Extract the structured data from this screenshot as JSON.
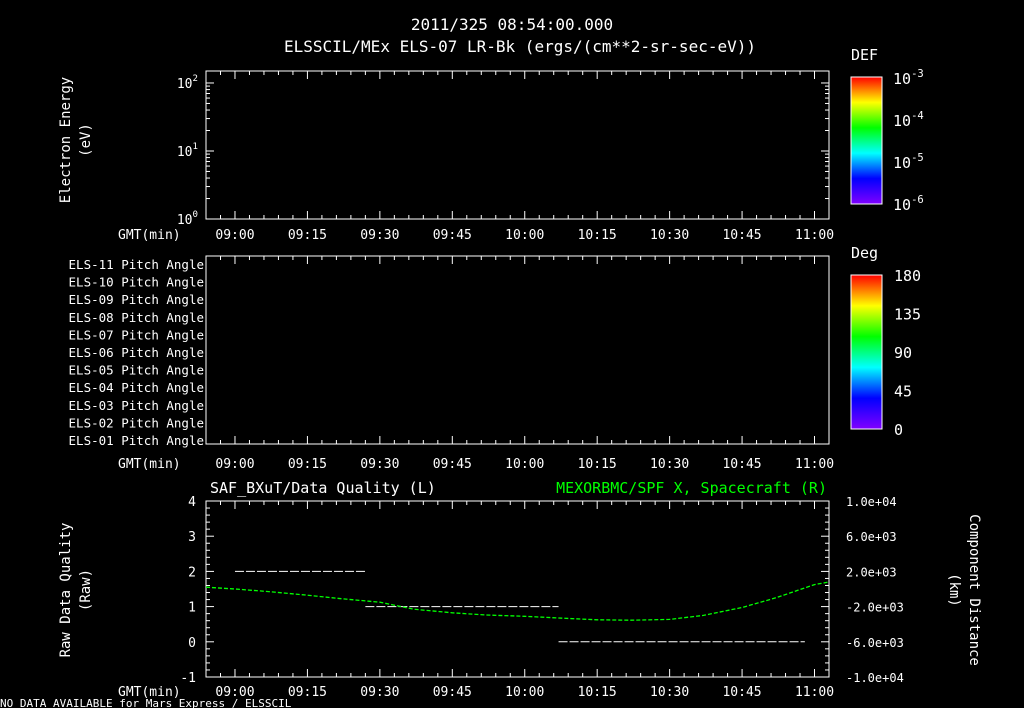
{
  "header": {
    "datetime": "2011/325 08:54:00.000",
    "title": "ELSSCIL/MEx ELS-07 LR-Bk  (ergs/(cm**2-sr-sec-eV))"
  },
  "footer": {
    "status": "NO DATA AVAILABLE for Mars Express / ELSSCIL"
  },
  "time_axis": {
    "label": "GMT(min)",
    "range": [
      "08:54",
      "11:03"
    ],
    "ticks": [
      "09:00",
      "09:15",
      "09:30",
      "09:45",
      "10:00",
      "10:15",
      "10:30",
      "10:45",
      "11:00"
    ]
  },
  "colors": {
    "background": "#000000",
    "axis": "#ffffff",
    "quality": "#ffffff",
    "distance": "#00ff00"
  },
  "chart_data": [
    {
      "type": "heatmap",
      "ylabel": "Electron Energy",
      "ylabel_units": "(eV)",
      "yscale": "log",
      "ylim": [
        1,
        150
      ],
      "yticks": [
        {
          "base": "10",
          "exp": "0",
          "value": 1
        },
        {
          "base": "10",
          "exp": "1",
          "value": 10
        },
        {
          "base": "10",
          "exp": "2",
          "value": 100
        }
      ],
      "colorbar": {
        "label": "DEF",
        "scale": "log",
        "range": [
          1e-06,
          0.001
        ],
        "ticks": [
          {
            "base": "10",
            "exp": "-3"
          },
          {
            "base": "10",
            "exp": "-4"
          },
          {
            "base": "10",
            "exp": "-5"
          },
          {
            "base": "10",
            "exp": "-6"
          }
        ]
      },
      "values": []
    },
    {
      "type": "heatmap",
      "rows": [
        "ELS-11 Pitch Angle",
        "ELS-10 Pitch Angle",
        "ELS-09 Pitch Angle",
        "ELS-08 Pitch Angle",
        "ELS-07 Pitch Angle",
        "ELS-06 Pitch Angle",
        "ELS-05 Pitch Angle",
        "ELS-04 Pitch Angle",
        "ELS-03 Pitch Angle",
        "ELS-02 Pitch Angle",
        "ELS-01 Pitch Angle"
      ],
      "colorbar": {
        "label": "Deg",
        "range": [
          0,
          180
        ],
        "ticks": [
          "180",
          "135",
          "90",
          "45",
          "0"
        ]
      },
      "values": []
    },
    {
      "type": "line",
      "title_left": "SAF_BXuT/Data Quality (L)",
      "title_right": "MEXORBMC/SPF X, Spacecraft (R)",
      "ylabel_left": "Raw Data Quality",
      "ylabel_left_units": "(Raw)",
      "ylabel_right": "Component Distance",
      "ylabel_right_units": "(km)",
      "ylim_left": [
        -1,
        4
      ],
      "yticks_left": [
        "4",
        "3",
        "2",
        "1",
        "0",
        "-1"
      ],
      "ylim_right": [
        -10000,
        10000
      ],
      "yticks_right": [
        "1.0e+04",
        "6.0e+03",
        "2.0e+03",
        "-2.0e+03",
        "-6.0e+03",
        "-1.0e+04"
      ],
      "series": [
        {
          "name": "SAF_BXuT/Data Quality",
          "axis": "left",
          "style": "segments",
          "segments": [
            {
              "start": "09:00",
              "end": "09:27",
              "value": 2
            },
            {
              "start": "09:27",
              "end": "10:07",
              "value": 1
            },
            {
              "start": "10:07",
              "end": "10:58",
              "value": 0
            }
          ]
        },
        {
          "name": "MEXORBMC/SPF X, Spacecraft",
          "axis": "right",
          "style": "dotted",
          "x": [
            "08:54",
            "09:00",
            "09:07",
            "09:15",
            "09:22",
            "09:30",
            "09:37",
            "09:45",
            "09:52",
            "10:00",
            "10:07",
            "10:15",
            "10:22",
            "10:30",
            "10:37",
            "10:45",
            "10:52",
            "11:00",
            "11:03"
          ],
          "y": [
            200,
            0,
            -300,
            -700,
            -1100,
            -1500,
            -2300,
            -2700,
            -2950,
            -3100,
            -3300,
            -3500,
            -3550,
            -3450,
            -3000,
            -2100,
            -1000,
            500,
            800
          ]
        }
      ]
    }
  ]
}
